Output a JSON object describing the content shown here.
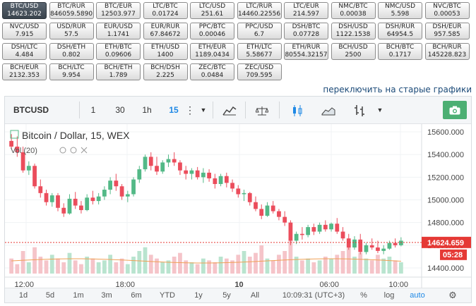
{
  "pairs": [
    {
      "name": "BTC/USD",
      "value": "14623.202",
      "active": true
    },
    {
      "name": "BTC/RUR",
      "value": "846059.5890"
    },
    {
      "name": "BTC/EUR",
      "value": "12503.977"
    },
    {
      "name": "LTC/BTC",
      "value": "0.01724"
    },
    {
      "name": "LTC/USD",
      "value": "251.61"
    },
    {
      "name": "LTC/RUR",
      "value": "14460.22556"
    },
    {
      "name": "LTC/EUR",
      "value": "214.597"
    },
    {
      "name": "NMC/BTC",
      "value": "0.00038"
    },
    {
      "name": "NMC/USD",
      "value": "5.598"
    },
    {
      "name": "NVC/BTC",
      "value": "0.00053"
    },
    {
      "name": "NVC/USD",
      "value": "7.915"
    },
    {
      "name": "USD/RUR",
      "value": "57.5"
    },
    {
      "name": "EUR/USD",
      "value": "1.1741"
    },
    {
      "name": "EUR/RUR",
      "value": "67.84672"
    },
    {
      "name": "PPC/BTC",
      "value": "0.00046"
    },
    {
      "name": "PPC/USD",
      "value": "6.7"
    },
    {
      "name": "DSH/BTC",
      "value": "0.07728"
    },
    {
      "name": "DSH/USD",
      "value": "1122.1538"
    },
    {
      "name": "DSH/RUR",
      "value": "64954.5"
    },
    {
      "name": "DSH/EUR",
      "value": "957.585"
    },
    {
      "name": "DSH/LTC",
      "value": "4.484"
    },
    {
      "name": "DSH/ETH",
      "value": "0.802"
    },
    {
      "name": "ETH/BTC",
      "value": "0.09606"
    },
    {
      "name": "ETH/USD",
      "value": "1400"
    },
    {
      "name": "ETH/EUR",
      "value": "1189.0434"
    },
    {
      "name": "ETH/LTC",
      "value": "5.58677"
    },
    {
      "name": "ETH/RUR",
      "value": "80554.32157"
    },
    {
      "name": "BCH/USD",
      "value": "2500"
    },
    {
      "name": "BCH/BTC",
      "value": "0.1717"
    },
    {
      "name": "BCH/RUR",
      "value": "145228.823"
    },
    {
      "name": "BCH/EUR",
      "value": "2132.353"
    },
    {
      "name": "BCH/LTC",
      "value": "9.954"
    },
    {
      "name": "BCH/ETH",
      "value": "1.789"
    },
    {
      "name": "BCH/DSH",
      "value": "2.225"
    },
    {
      "name": "ZEC/BTC",
      "value": "0.0484"
    },
    {
      "name": "ZEC/USD",
      "value": "709.595"
    }
  ],
  "switch_link": "переключить на старые графики",
  "toolbar": {
    "symbol": "BTCUSD",
    "intervals": [
      "1",
      "30",
      "1h",
      "15"
    ],
    "active_interval": "15",
    "more_icon": "vertical-dots-icon",
    "dropdown_icon": "chevron-down-icon",
    "indicators_icon": "indicators-icon",
    "compare_icon": "scales-icon",
    "candles_icon": "candlestick-icon",
    "area_icon": "area-chart-icon",
    "bars_icon": "bar-chart-style-icon",
    "camera_icon": "camera-icon"
  },
  "legend": {
    "title": "Bitcoin / Dollar, 15, WEX",
    "volume": "Vol (20)"
  },
  "price_axis": {
    "ticks": [
      "15600.000",
      "15400.000",
      "15200.000",
      "15000.000",
      "14800.000",
      "14600.000",
      "14400.000"
    ]
  },
  "current_price": "14624.659",
  "countdown": "05:28",
  "time_axis": {
    "ticks": [
      "12:00",
      "18:00",
      "10",
      "06:00",
      "10:00"
    ]
  },
  "bottom": {
    "ranges": [
      "1d",
      "5d",
      "1m",
      "3m",
      "6m",
      "YTD",
      "1y",
      "5y",
      "All"
    ],
    "time": "10:09:31 (UTC+3)",
    "percent": "%",
    "log": "log",
    "auto": "auto",
    "settings_icon": "gear-icon"
  },
  "colors": {
    "up": "#53b987",
    "down": "#eb4d5c",
    "accent": "#1e88e5",
    "active_pair": "#3f4951",
    "camera": "#4caf73"
  },
  "chart_data": {
    "type": "candlestick",
    "title": "Bitcoin / Dollar, 15, WEX",
    "ylim": [
      14350,
      15650
    ],
    "x_ticks": [
      "12:00",
      "18:00",
      "10",
      "06:00",
      "10:00"
    ],
    "candles": [
      [
        15520,
        15580,
        15450,
        15470
      ],
      [
        15470,
        15560,
        15380,
        15420
      ],
      [
        15420,
        15470,
        15240,
        15260
      ],
      [
        15260,
        15340,
        15220,
        15300
      ],
      [
        15300,
        15320,
        15100,
        15120
      ],
      [
        15120,
        15180,
        15020,
        15060
      ],
      [
        15060,
        15090,
        14950,
        14980
      ],
      [
        14980,
        15060,
        14940,
        15040
      ],
      [
        15040,
        15060,
        14900,
        14930
      ],
      [
        14930,
        14970,
        14850,
        14880
      ],
      [
        14880,
        15050,
        14870,
        15010
      ],
      [
        15010,
        15070,
        14920,
        14950
      ],
      [
        14950,
        14990,
        14880,
        14910
      ],
      [
        14910,
        15050,
        14900,
        15020
      ],
      [
        15020,
        15080,
        14960,
        14990
      ],
      [
        14990,
        15060,
        14960,
        15030
      ],
      [
        15030,
        15120,
        15000,
        15090
      ],
      [
        15090,
        15200,
        15050,
        15170
      ],
      [
        15170,
        15230,
        15080,
        15120
      ],
      [
        15120,
        15140,
        15000,
        15030
      ],
      [
        15030,
        15080,
        14980,
        15050
      ],
      [
        15050,
        15200,
        15030,
        15180
      ],
      [
        15180,
        15300,
        15150,
        15270
      ],
      [
        15270,
        15400,
        15250,
        15380
      ],
      [
        15380,
        15420,
        15260,
        15300
      ],
      [
        15300,
        15380,
        15220,
        15250
      ],
      [
        15250,
        15350,
        15230,
        15330
      ],
      [
        15330,
        15400,
        15290,
        15360
      ],
      [
        15360,
        15420,
        15300,
        15330
      ],
      [
        15330,
        15350,
        15220,
        15260
      ],
      [
        15260,
        15300,
        15180,
        15230
      ],
      [
        15230,
        15280,
        15180,
        15260
      ],
      [
        15260,
        15290,
        15180,
        15200
      ],
      [
        15200,
        15280,
        15150,
        15240
      ],
      [
        15240,
        15270,
        15160,
        15190
      ],
      [
        15190,
        15230,
        15100,
        15140
      ],
      [
        15140,
        15230,
        15120,
        15210
      ],
      [
        15210,
        15240,
        15110,
        15150
      ],
      [
        15150,
        15180,
        15070,
        15100
      ],
      [
        15100,
        15130,
        15020,
        15050
      ],
      [
        15050,
        15090,
        14990,
        15060
      ],
      [
        15060,
        15070,
        14950,
        14980
      ],
      [
        14980,
        15030,
        14900,
        14920
      ],
      [
        14920,
        14960,
        14830,
        14860
      ],
      [
        14860,
        14980,
        14850,
        14950
      ],
      [
        14950,
        14990,
        14880,
        14900
      ],
      [
        14900,
        14920,
        14820,
        14850
      ],
      [
        14850,
        14900,
        14770,
        14800
      ],
      [
        14800,
        14820,
        14600,
        14640
      ],
      [
        14640,
        14720,
        14610,
        14700
      ],
      [
        14700,
        14760,
        14650,
        14690
      ],
      [
        14690,
        14780,
        14670,
        14760
      ],
      [
        14760,
        14790,
        14690,
        14720
      ],
      [
        14720,
        14800,
        14700,
        14780
      ],
      [
        14780,
        14820,
        14720,
        14740
      ],
      [
        14740,
        14800,
        14720,
        14790
      ],
      [
        14790,
        14840,
        14700,
        14720
      ],
      [
        14720,
        14760,
        14640,
        14660
      ],
      [
        14660,
        14700,
        14560,
        14580
      ],
      [
        14580,
        14680,
        14560,
        14650
      ],
      [
        14650,
        14700,
        14520,
        14540
      ],
      [
        14540,
        14620,
        14520,
        14600
      ],
      [
        14600,
        14660,
        14560,
        14580
      ],
      [
        14580,
        14640,
        14530,
        14550
      ],
      [
        14550,
        14600,
        14520,
        14570
      ],
      [
        14570,
        14640,
        14560,
        14620
      ],
      [
        14620,
        14660,
        14580,
        14600
      ],
      [
        14600,
        14670,
        14590,
        14640
      ]
    ],
    "volume": [
      8,
      5,
      12,
      6,
      14,
      9,
      7,
      10,
      8,
      6,
      11,
      7,
      5,
      9,
      8,
      6,
      7,
      10,
      6,
      8,
      5,
      9,
      12,
      14,
      10,
      8,
      6,
      7,
      9,
      11,
      7,
      6,
      5,
      8,
      7,
      6,
      9,
      8,
      7,
      10,
      12,
      9,
      11,
      15,
      8,
      7,
      10,
      12,
      18,
      9,
      7,
      8,
      6,
      7,
      9,
      8,
      10,
      12,
      14,
      9,
      11,
      8,
      7,
      10,
      8,
      9,
      7,
      6
    ]
  }
}
